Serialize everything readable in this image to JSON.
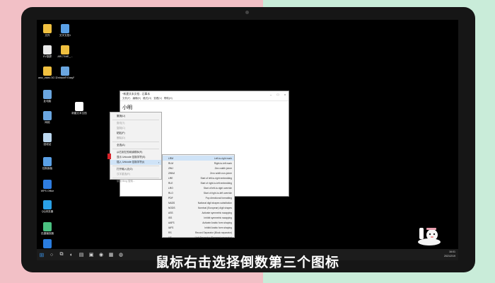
{
  "desktop_icons": [
    {
      "label": "文件",
      "color": "#f0c040"
    },
    {
      "label": "文字文档1",
      "color": "#5aa0e6"
    },
    {
      "label": "EV录屏",
      "color": "#e8e8e8"
    },
    {
      "label": "ARCTIME_...",
      "color": "#f0c040"
    },
    {
      "label": "amz_video 3G 100 5...",
      "color": "#f0c040"
    },
    {
      "label": "Ontrack® EasyRecov...",
      "color": "#6aa6e0"
    },
    {
      "label": "此电脑",
      "color": "#6aa6e0"
    },
    {
      "label": "新建文本文档",
      "color": "#ffffff"
    },
    {
      "label": "网络",
      "color": "#6aa6e0"
    },
    {
      "label": "回收站",
      "color": "#bcd8f0"
    },
    {
      "label": "控制面板",
      "color": "#5aa0e6"
    },
    {
      "label": "WPS Office",
      "color": "#2f7de0"
    },
    {
      "label": "QQ浏览器",
      "color": "#2aa0e6"
    },
    {
      "label": "迅捷播放器",
      "color": "#4ac080"
    },
    {
      "label": "",
      "color": "#2a7de0"
    }
  ],
  "notepad": {
    "title": "*新建文本文档 - 记事本",
    "minimize": "–",
    "maximize": "□",
    "close": "×",
    "menu": [
      "文件(F)",
      "编辑(E)",
      "格式(O)",
      "查看(V)",
      "帮助(H)"
    ],
    "content": "小明"
  },
  "context_menu": {
    "items": [
      {
        "label": "撤销(U)",
        "disabled": false
      },
      {
        "sep": true
      },
      {
        "label": "剪切(T)",
        "disabled": true
      },
      {
        "label": "复制(C)",
        "disabled": true
      },
      {
        "label": "粘贴(P)",
        "disabled": false
      },
      {
        "label": "删除(D)",
        "disabled": true
      },
      {
        "sep": true
      },
      {
        "label": "全选(A)",
        "disabled": false
      },
      {
        "sep": true
      },
      {
        "label": "从右到左的阅读顺序(R)",
        "disabled": false
      },
      {
        "label": "显示 Unicode 控制字符(S)",
        "disabled": false
      },
      {
        "label": "插入 Unicode 控制字符(I)",
        "disabled": false,
        "highlight": true,
        "submenu": true
      },
      {
        "sep": true
      },
      {
        "label": "打开输入法(O)",
        "disabled": false
      },
      {
        "label": "汉字重选(R)",
        "disabled": true
      },
      {
        "sep": true
      },
      {
        "label": "使用 Bing 搜索...",
        "disabled": true
      }
    ]
  },
  "submenu": {
    "rows": [
      {
        "code": "LRM",
        "desc": "Left-to-right mark",
        "highlight": true
      },
      {
        "code": "RLM",
        "desc": "Right-to-left mark"
      },
      {
        "code": "ZWJ",
        "desc": "Zero width joiner"
      },
      {
        "code": "ZWNJ",
        "desc": "Zero width non-joiner"
      },
      {
        "code": "LRE",
        "desc": "Start of left-to-right embedding"
      },
      {
        "code": "RLE",
        "desc": "Start of right-to-left embedding"
      },
      {
        "code": "LRO",
        "desc": "Start of left-to-right override"
      },
      {
        "code": "RLO",
        "desc": "Start of right-to-left override"
      },
      {
        "code": "PDF",
        "desc": "Pop directional formatting"
      },
      {
        "code": "NADS",
        "desc": "National digit shapes substitution"
      },
      {
        "code": "NODS",
        "desc": "Nominal (European) digit shapes"
      },
      {
        "code": "ASS",
        "desc": "Activate symmetric swapping"
      },
      {
        "code": "ISS",
        "desc": "Inhibit symmetric swapping"
      },
      {
        "code": "AAFS",
        "desc": "Activate Arabic form shaping"
      },
      {
        "code": "IAFS",
        "desc": "Inhibit Arabic form shaping"
      },
      {
        "code": "RS",
        "desc": "Record Separator (Block separator)"
      },
      {
        "code": "US",
        "desc": "Unit Separator (Segment separator)"
      }
    ]
  },
  "taskbar": {
    "start_glyph": "⊞",
    "icons": [
      {
        "name": "search-icon",
        "glyph": "○"
      },
      {
        "name": "task-view-icon",
        "glyph": "⧉"
      },
      {
        "name": "edge-icon",
        "glyph": "◐"
      },
      {
        "name": "explorer-icon",
        "glyph": "▤"
      },
      {
        "name": "store-icon",
        "glyph": "▣"
      },
      {
        "name": "app-icon",
        "glyph": "◉"
      },
      {
        "name": "notepad-icon",
        "glyph": "▦"
      },
      {
        "name": "chrome-icon",
        "glyph": "◍"
      }
    ],
    "time": "16:01",
    "date": "2021/2/19"
  },
  "subtitle": "鼠标右击选择倒数第三个图标",
  "colors": {
    "pink": "#f2c0c6",
    "mint": "#c9ecd9",
    "highlight": "#cfe3f7",
    "marker": "#d8232a"
  }
}
